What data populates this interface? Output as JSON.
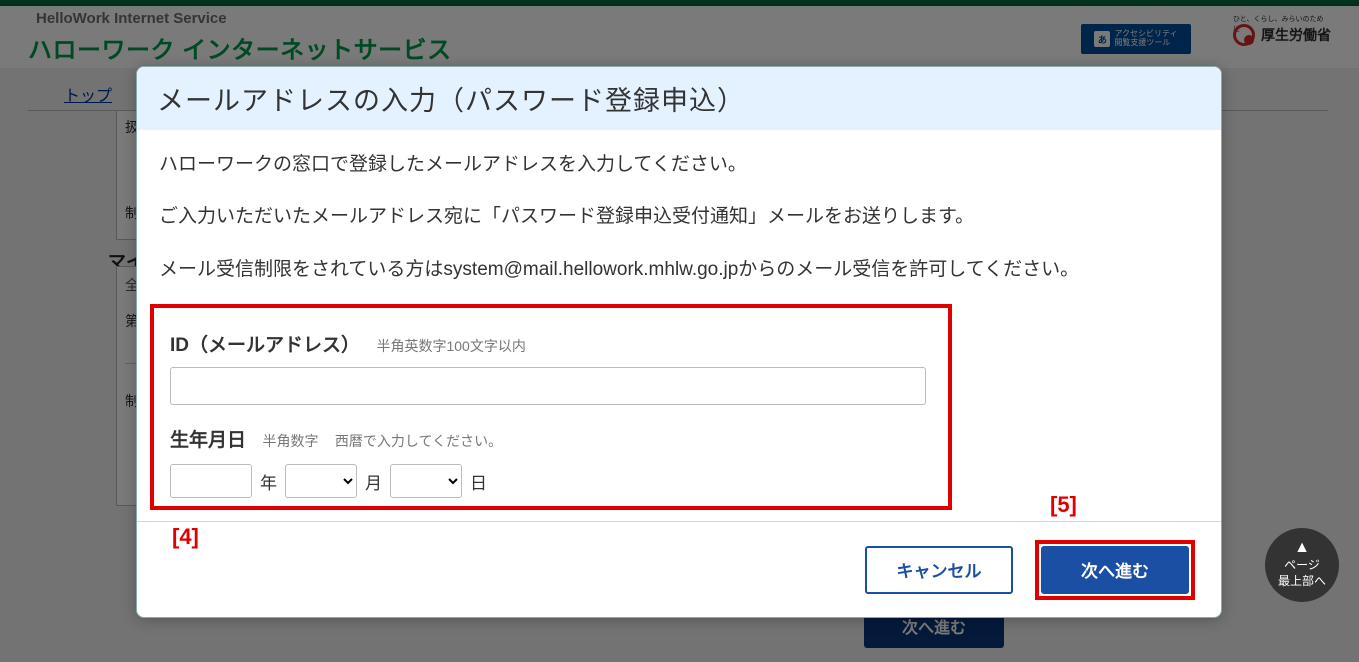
{
  "bg": {
    "service_en": "HelloWork Internet Service",
    "service_jp": "ハローワーク インターネットサービス",
    "acc_badge_char": "あ",
    "acc_badge_text": "アクセシビリティ\n閲覧支援ツール",
    "mhlw": "厚生労働省",
    "mhlw_sub": "ひと、くらし、みらいのために",
    "top_link": "トップ",
    "box1_l1": "扱",
    "box1_l2": "制",
    "box2_head": "マイ",
    "box2_l1": "全",
    "box2_l2": "第",
    "box2_l4": "制",
    "next": "次へ進む"
  },
  "pagetop": {
    "line1": "ページ",
    "line2": "最上部へ"
  },
  "modal": {
    "title": "メールアドレスの入力（パスワード登録申込）",
    "p1": "ハローワークの窓口で登録したメールアドレスを入力してください。",
    "p2": "ご入力いただいたメールアドレス宛に「パスワード登録申込受付通知」メールをお送りします。",
    "p3": "メール受信制限をされている方はsystem@mail.hellowork.mhlw.go.jpからのメール受信を許可してください。",
    "id_label": "ID（メールアドレス）",
    "id_hint": "半角英数字100文字以内",
    "dob_label": "生年月日",
    "dob_hint1": "半角数字",
    "dob_hint2": "西暦で入力してください。",
    "unit_year": "年",
    "unit_month": "月",
    "unit_day": "日",
    "cancel": "キャンセル",
    "next": "次へ進む"
  },
  "callouts": {
    "c4": "[4]",
    "c5": "[5]"
  }
}
